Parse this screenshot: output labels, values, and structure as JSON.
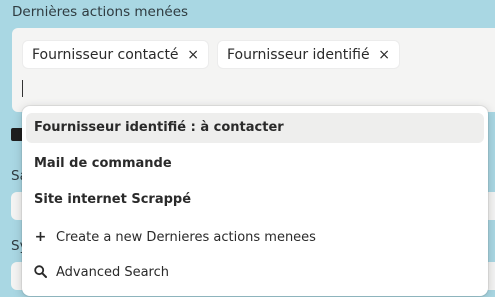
{
  "field": {
    "label": "Dernières actions menées",
    "chips": [
      {
        "label": "Fournisseur contacté",
        "remove_glyph": "×"
      },
      {
        "label": "Fournisseur identifié",
        "remove_glyph": "×"
      }
    ]
  },
  "background": {
    "label_1": "Sa",
    "label_2": "Sy"
  },
  "dropdown": {
    "options": [
      {
        "label": "Fournisseur identifié : à contacter",
        "highlighted": true
      },
      {
        "label": "Mail de commande"
      },
      {
        "label": "Site internet Scrappé"
      }
    ],
    "create_label": "Create a new Dernieres actions menees",
    "create_icon": "plus-icon",
    "advanced_label": "Advanced Search",
    "advanced_icon": "search-icon"
  },
  "colors": {
    "page_bg": "#a9d7e3",
    "field_bg": "#f4f4f3",
    "highlight_bg": "#eeeeed"
  }
}
